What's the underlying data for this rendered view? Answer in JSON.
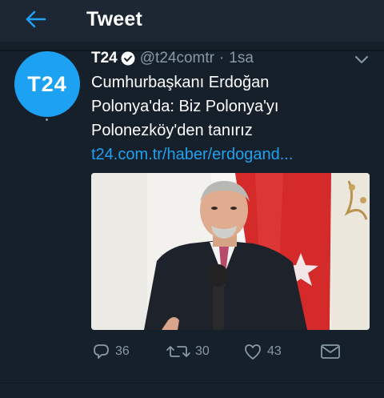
{
  "header": {
    "title": "Tweet"
  },
  "tweet": {
    "avatar_text": "T24",
    "author_name": "T24",
    "handle": "@t24comtr",
    "separator": "·",
    "time": "1sa",
    "text_lines": [
      "Cumhurbaşkanı Erdoğan",
      "Polonya'da: Biz Polonya'yı",
      "Polonezköy'den tanırız"
    ],
    "link": "t24.com.tr/haber/erdogand...",
    "stats": {
      "replies": "36",
      "retweets": "30",
      "likes": "43"
    }
  },
  "colors": {
    "background": "#15202b",
    "accent": "#1da1f2",
    "muted": "#8899a6"
  },
  "icons": [
    "back-arrow-icon",
    "verified-icon",
    "chevron-down-icon",
    "reply-icon",
    "retweet-icon",
    "like-icon",
    "share-icon"
  ]
}
